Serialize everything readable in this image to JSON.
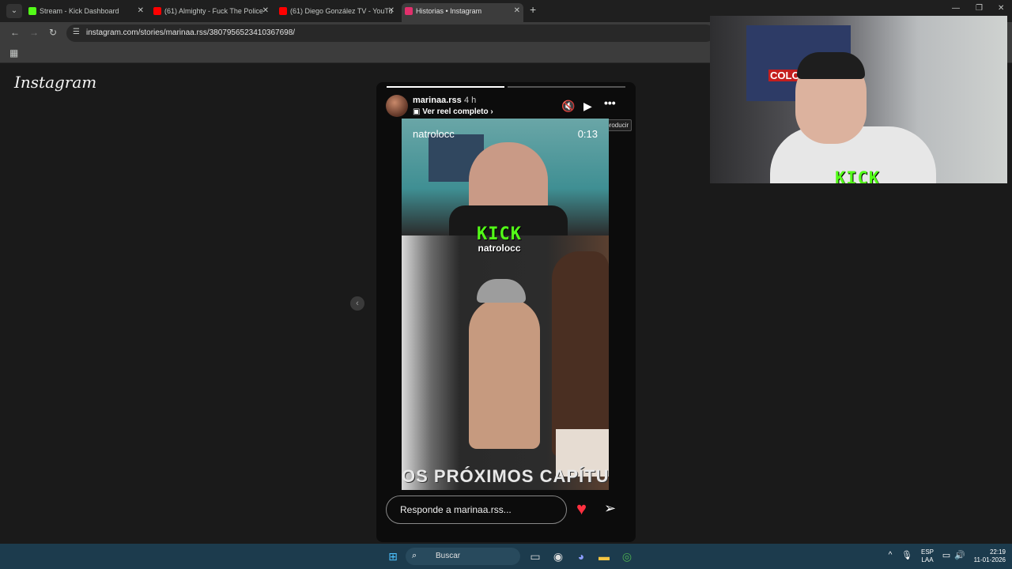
{
  "browser": {
    "tabs": [
      {
        "title": "Stream - Kick Dashboard",
        "favicon_color": "#53fc18",
        "active": false
      },
      {
        "title": "(61) Almighty - Fuck The Police",
        "favicon_color": "#ff0000",
        "active": false
      },
      {
        "title": "(61) Diego González TV - YouTu",
        "favicon_color": "#ff0000",
        "active": false
      },
      {
        "title": "Historias • Instagram",
        "favicon_color": "#e1306c",
        "active": true
      }
    ],
    "url": "instagram.com/stories/marinaa.rss/3807956523410367698/"
  },
  "page": {
    "logo": "Instagram",
    "story": {
      "progress": [
        1.0,
        0.0
      ],
      "username": "marinaa.rss",
      "time": "4 h",
      "reel_link": "Ver reel completo",
      "tooltip": "Reproducir",
      "video_channel": "natrolocc",
      "video_time": "0:13",
      "subtitle": "OS PRÓXIMOS CAPÍTU",
      "reply_placeholder": "Responde a marinaa.rss..."
    }
  },
  "watermark": {
    "brand": "KICK",
    "channel": "natrolocc"
  },
  "webcam": {
    "flag_text": "COLO-C"
  },
  "taskbar": {
    "search_label": "Buscar",
    "language": "ESP",
    "layout": "LAA",
    "time": "22:19",
    "date": "11-01-2026"
  },
  "colors": {
    "accent_kick": "#53fc18",
    "heart": "#ff3040",
    "taskbar": "#1c3b4d"
  }
}
